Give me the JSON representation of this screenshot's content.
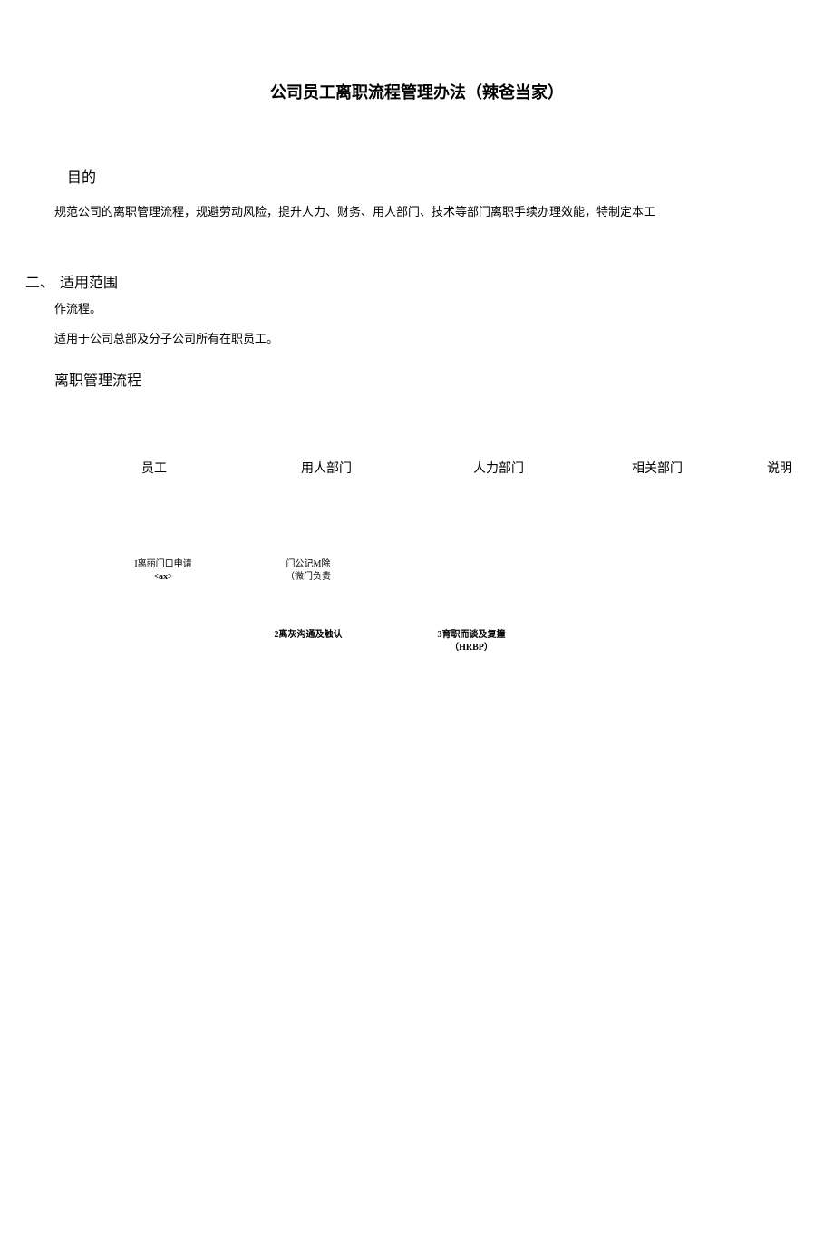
{
  "title": "公司员工离职流程管理办法（辣爸当家）",
  "section1": {
    "heading": "目的",
    "paragraph": "规范公司的离职管理流程，规避劳动风险，提升人力、财务、用人部门、技术等部门离职手续办理效能，特制定本工"
  },
  "section2": {
    "number": "二、",
    "heading": "适用范围",
    "cont": "作流程。",
    "paragraph": "适用于公司总部及分子公司所有在职员工。"
  },
  "section3": {
    "heading": "离职管理流程"
  },
  "columns": {
    "c1": "员工",
    "c2": "用人部门",
    "c3": "人力部门",
    "c4": "相关部门",
    "c5": "说明"
  },
  "flow": {
    "box1_line1": "I离丽门口申请",
    "box1_line2": "<ax>",
    "box2_line1": "门公记M除",
    "box2_line2": "（微门负责",
    "box3": "2离灰沟通及触认",
    "box4_line1": "3育职而谈及复撞",
    "box4_line2": "（HRBP）"
  }
}
